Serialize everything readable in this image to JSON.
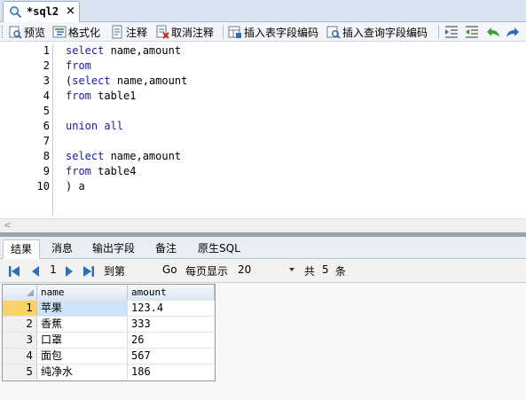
{
  "tab": {
    "title": "*sql2",
    "close": "×"
  },
  "toolbar": {
    "preview": "预览",
    "format": "格式化",
    "comment": "注释",
    "uncomment": "取消注释",
    "insert_table_field_code": "插入表字段编码",
    "insert_query_field_code": "插入查询字段编码"
  },
  "editor": {
    "line_numbers": [
      "1",
      "2",
      "3",
      "4",
      "5",
      "6",
      "7",
      "8",
      "9",
      "10"
    ],
    "lines": [
      [
        {
          "t": "select",
          "k": true
        },
        {
          "t": " name,amount",
          "k": false
        }
      ],
      [
        {
          "t": "from",
          "k": true
        }
      ],
      [
        {
          "t": "(",
          "k": false
        },
        {
          "t": "select",
          "k": true
        },
        {
          "t": " name,amount",
          "k": false
        }
      ],
      [
        {
          "t": "from",
          "k": true
        },
        {
          "t": " table1",
          "k": false
        }
      ],
      [],
      [
        {
          "t": "union all",
          "k": true
        }
      ],
      [],
      [
        {
          "t": "select",
          "k": true
        },
        {
          "t": " name,amount",
          "k": false
        }
      ],
      [
        {
          "t": "from",
          "k": true
        },
        {
          "t": " table4",
          "k": false
        }
      ],
      [
        {
          "t": ") a",
          "k": false
        }
      ]
    ]
  },
  "result_tabs": [
    "结果",
    "消息",
    "输出字段",
    "备注",
    "原生SQL"
  ],
  "pager": {
    "page": "1",
    "goto_page": "到第",
    "go": "Go",
    "per_page_label": "每页显示",
    "per_page_value": "20",
    "total_prefix": "共",
    "total_count": "5",
    "total_suffix": "条"
  },
  "grid": {
    "columns": [
      "name",
      "amount"
    ],
    "rows": [
      {
        "n": "1",
        "name": "苹果",
        "amount": "123.4"
      },
      {
        "n": "2",
        "name": "香蕉",
        "amount": "333"
      },
      {
        "n": "3",
        "name": "口罩",
        "amount": "26"
      },
      {
        "n": "4",
        "name": "面包",
        "amount": "567"
      },
      {
        "n": "5",
        "name": "纯净水",
        "amount": "186"
      }
    ],
    "selected_row": 0
  },
  "colors": {
    "keyword": "#1a1aa6",
    "selected_row_header": "#f7d36a",
    "selected_cell": "#cde3f7"
  }
}
